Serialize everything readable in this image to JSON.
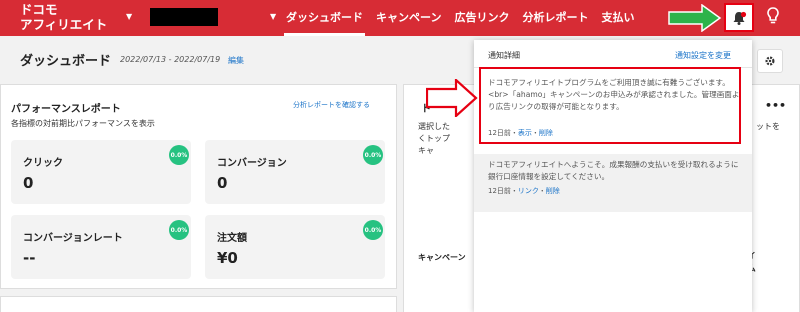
{
  "header": {
    "logo_line1": "ドコモ",
    "logo_line2": "アフィリエイト",
    "nav": [
      "ダッシュボード",
      "キャンペーン",
      "広告リンク",
      "分析レポート",
      "支払い"
    ],
    "active_nav": "ダッシュボード"
  },
  "page": {
    "title": "ダッシュボード",
    "date_range": "2022/07/13 - 2022/07/19",
    "edit": "編集"
  },
  "performance": {
    "title": "パフォーマンスレポート",
    "link": "分析レポートを確認する",
    "subtitle": "各指標の対前期比パフォーマンスを表示",
    "metrics": [
      {
        "label": "クリック",
        "value": "0",
        "badge": "0.0%"
      },
      {
        "label": "コンバージョン",
        "value": "0",
        "badge": "0.0%"
      },
      {
        "label": "コンバージョンレート",
        "value": "--",
        "badge": "0.0%"
      },
      {
        "label": "注文額",
        "value": "¥0",
        "badge": "0.0%"
      }
    ]
  },
  "right_card": {
    "title_fragment": "ト",
    "more": "•••",
    "left_line1": "選択した",
    "left_line2": "くトップ",
    "left_line3": "キャ",
    "right_fragment": "ットを",
    "col_campaign": "キャンペーン",
    "col_item": "アイテム"
  },
  "notifications": {
    "title": "通知詳細",
    "settings_link": "通知設定を変更",
    "items": [
      {
        "text": "ドコモアフィリエイトプログラムをご利用頂き誠に有難うございます。<br>「ahamo」キャンペーンのお申込みが承認されました。管理画面より広告リンクの取得が可能となります。",
        "age": "12日前",
        "actions": [
          "表示",
          "削除"
        ]
      },
      {
        "text": "ドコモアフィリエイトへようこそ。成果報酬の支払いを受け取れるように銀行口座情報を設定してください。",
        "age": "12日前",
        "actions": [
          "リンク",
          "削除"
        ]
      }
    ]
  },
  "colors": {
    "brand_red": "#d72c35",
    "badge_green": "#26c281",
    "link_blue": "#1a73c8",
    "annotation_green": "#2db34a",
    "annotation_red": "#e60012"
  }
}
